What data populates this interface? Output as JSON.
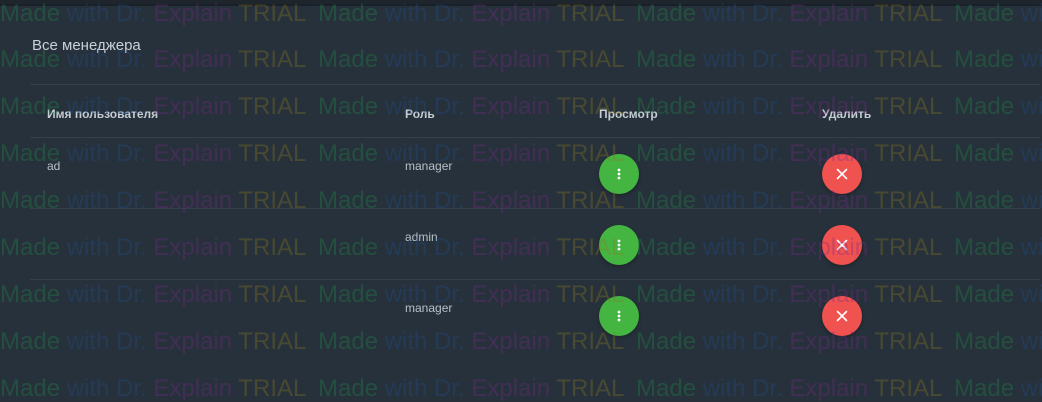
{
  "card": {
    "title": "Все менеджера"
  },
  "table": {
    "headers": {
      "username": "Имя пользователя",
      "role": "Роль",
      "view": "Просмотр",
      "delete": "Удалить"
    },
    "rows": [
      {
        "username": "ad",
        "role": "manager"
      },
      {
        "username": "",
        "role": "admin"
      },
      {
        "username": "",
        "role": "manager"
      }
    ]
  },
  "icons": {
    "view": "more-vertical-icon",
    "delete": "close-icon"
  },
  "colors": {
    "view_button": "#45b542",
    "delete_button": "#f0524f",
    "card_background": "#27313b"
  },
  "watermark": {
    "made": "Made",
    "with": "with Dr.",
    "explain": "Explain",
    "trial": "TRIAL"
  }
}
